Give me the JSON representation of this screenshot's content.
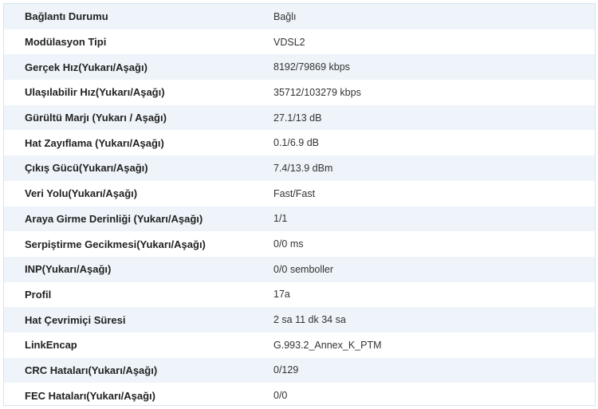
{
  "status_table": {
    "rows": [
      {
        "label": "Bağlantı Durumu",
        "value": "Bağlı"
      },
      {
        "label": "Modülasyon Tipi",
        "value": "VDSL2"
      },
      {
        "label": "Gerçek Hız(Yukarı/Aşağı)",
        "value": "8192/79869 kbps"
      },
      {
        "label": "Ulaşılabilir Hız(Yukarı/Aşağı)",
        "value": "35712/103279 kbps"
      },
      {
        "label": "Gürültü Marjı (Yukarı / Aşağı)",
        "value": "27.1/13 dB"
      },
      {
        "label": "Hat Zayıflama (Yukarı/Aşağı)",
        "value": "0.1/6.9 dB"
      },
      {
        "label": "Çıkış Gücü(Yukarı/Aşağı)",
        "value": "7.4/13.9 dBm"
      },
      {
        "label": "Veri Yolu(Yukarı/Aşağı)",
        "value": "Fast/Fast"
      },
      {
        "label": "Araya Girme Derinliği (Yukarı/Aşağı)",
        "value": "1/1"
      },
      {
        "label": "Serpiştirme Gecikmesi(Yukarı/Aşağı)",
        "value": "0/0 ms"
      },
      {
        "label": "INP(Yukarı/Aşağı)",
        "value": "0/0 semboller"
      },
      {
        "label": "Profil",
        "value": "17a"
      },
      {
        "label": "Hat Çevrimiçi Süresi",
        "value": "2 sa 11 dk 34 sa"
      },
      {
        "label": "LinkEncap",
        "value": "G.993.2_Annex_K_PTM"
      },
      {
        "label": "CRC Hataları(Yukarı/Aşağı)",
        "value": "0/129"
      },
      {
        "label": "FEC Hataları(Yukarı/Aşağı)",
        "value": "0/0"
      }
    ]
  },
  "colors": {
    "alternate_row_background": "#eef4f9",
    "border": "#d6e4ef",
    "label_text": "#222222",
    "value_text": "#333333"
  }
}
